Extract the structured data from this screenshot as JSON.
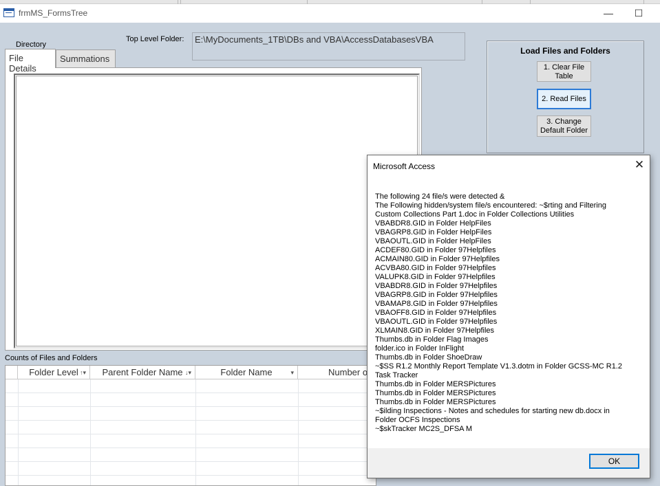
{
  "window": {
    "title": "frmMS_FormsTree",
    "minimize_glyph": "—",
    "maximize_glyph": "☐"
  },
  "form": {
    "directory_label": "Directory",
    "top_folder_label": "Top Level Folder:",
    "top_folder_value": "E:\\MyDocuments_1TB\\DBs and VBA\\AccessDatabasesVBA",
    "tabs": [
      {
        "label": "File Details",
        "active": true
      },
      {
        "label": "Summations",
        "active": false
      }
    ],
    "load_frame": {
      "title": "Load Files and Folders",
      "buttons": [
        {
          "label": "1. Clear File Table"
        },
        {
          "label": "2. Read Files"
        },
        {
          "label": "3. Change Default Folder"
        }
      ]
    },
    "counts_label": "Counts of Files and Folders",
    "grid": {
      "columns": [
        {
          "label": "Folder Level",
          "sort": "↑▾"
        },
        {
          "label": "Parent Folder Name",
          "sort": "↓▾"
        },
        {
          "label": "Folder Name",
          "sort": "▾"
        },
        {
          "label": "Number of",
          "sort": ""
        }
      ]
    }
  },
  "dialog": {
    "title": "Microsoft Access",
    "close_glyph": "✕",
    "lines": [
      "The following 24 file/s  were detected &",
      " The Following hidden/system file/s encountered: ~$rting and Filtering",
      "Custom Collections Part 1.doc in Folder Collections Utilities",
      "VBABDR8.GID in Folder HelpFiles",
      "VBAGRP8.GID in Folder HelpFiles",
      "VBAOUTL.GID in Folder HelpFiles",
      "ACDEF80.GID in Folder 97Helpfiles",
      "ACMAIN80.GID in Folder 97Helpfiles",
      "ACVBA80.GID in Folder 97Helpfiles",
      "VALUPK8.GID in Folder 97Helpfiles",
      "VBABDR8.GID in Folder 97Helpfiles",
      "VBAGRP8.GID in Folder 97Helpfiles",
      "VBAMAP8.GID in Folder 97Helpfiles",
      "VBAOFF8.GID in Folder 97Helpfiles",
      "VBAOUTL.GID in Folder 97Helpfiles",
      "XLMAIN8.GID in Folder 97Helpfiles",
      "Thumbs.db in Folder Flag Images",
      "folder.ico in Folder InFlight",
      "Thumbs.db in Folder ShoeDraw",
      "~$SS R1.2 Monthly Report Template V1.3.dotm in Folder GCSS-MC R1.2",
      "Task Tracker",
      "Thumbs.db in Folder MERSPictures",
      "Thumbs.db in Folder MERSPictures",
      "Thumbs.db in Folder MERSPictures",
      "~$ilding Inspections - Notes and schedules for starting new db.docx in",
      "Folder OCFS Inspections",
      "~$skTracker MC2S_DFSA M"
    ],
    "ok_label": "OK"
  }
}
